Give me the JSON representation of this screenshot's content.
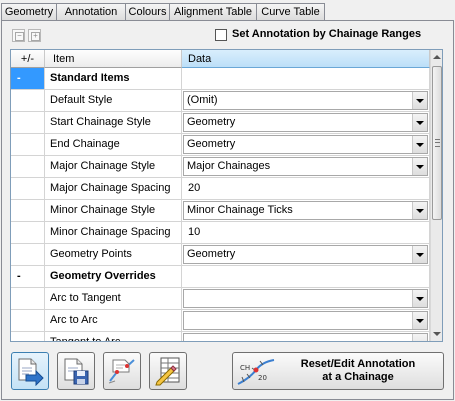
{
  "tabs": [
    {
      "label": "Geometry",
      "active": false
    },
    {
      "label": "Annotation",
      "active": true
    },
    {
      "label": "Colours",
      "active": false
    },
    {
      "label": "Alignment Table",
      "active": false
    },
    {
      "label": "Curve Table",
      "active": false
    }
  ],
  "toolbar": {
    "collapse_all_icon": "minus-square-icon",
    "expand_all_icon": "plus-square-icon",
    "chainage_ranges_checked": false,
    "chainage_ranges_label": "Set Annotation by Chainage Ranges"
  },
  "grid": {
    "headers": {
      "toggle": "+/-",
      "item": "Item",
      "data": "Data"
    },
    "rows": [
      {
        "kind": "section",
        "toggle": "-",
        "item": "Standard Items"
      },
      {
        "kind": "combo",
        "item": "Default Style",
        "value": "(Omit)"
      },
      {
        "kind": "combo",
        "item": "Start Chainage Style",
        "value": "Geometry"
      },
      {
        "kind": "combo",
        "item": "End Chainage",
        "value": "Geometry"
      },
      {
        "kind": "combo",
        "item": "Major Chainage Style",
        "value": "Major Chainages"
      },
      {
        "kind": "text",
        "item": "Major Chainage Spacing",
        "value": "20"
      },
      {
        "kind": "combo",
        "item": "Minor Chainage Style",
        "value": "Minor Chainage Ticks"
      },
      {
        "kind": "text",
        "item": "Minor Chainage Spacing",
        "value": "10"
      },
      {
        "kind": "combo",
        "item": "Geometry Points",
        "value": "Geometry"
      },
      {
        "kind": "section",
        "toggle": "-",
        "item": "Geometry Overrides"
      },
      {
        "kind": "combo",
        "item": "Arc to Tangent",
        "value": ""
      },
      {
        "kind": "combo",
        "item": "Arc to Arc",
        "value": ""
      },
      {
        "kind": "combo",
        "item": "Tangent to Arc",
        "value": ""
      }
    ]
  },
  "buttons": {
    "icons": [
      "load-settings-icon",
      "save-settings-icon",
      "pick-alignment-icon",
      "edit-table-icon"
    ],
    "reset_icon": "chainage-annotation-icon",
    "reset_line1": "Reset/Edit Annotation",
    "reset_line2": "at a Chainage"
  },
  "colors": {
    "accent": "#3399ff",
    "header_highlight": "#bcdff8",
    "border": "#7f9db9"
  }
}
